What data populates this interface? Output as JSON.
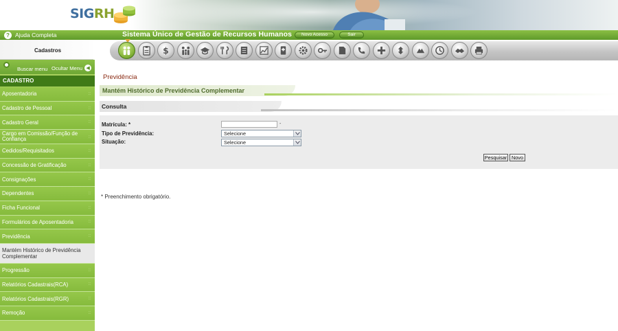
{
  "header": {
    "logo": {
      "part1": "SIG",
      "part2": "RH"
    },
    "help_link": "Ajuda Completa",
    "system_title": "Sistema Único de Gestão de Recursos Humanos",
    "novo_acesso": "Novo Acesso",
    "sair": "Sair"
  },
  "section_tab": "Cadastros",
  "module_icons": [
    "people-icon",
    "clipboard-icon",
    "dollar-icon",
    "family-icon",
    "graduation-cap-icon",
    "tools-icon",
    "document-icon",
    "chart-icon",
    "doctor-icon",
    "gear-icon",
    "key-icon",
    "page-icon",
    "phone-icon",
    "plus-icon",
    "transfer-icon",
    "hands-icon",
    "clock-icon",
    "handshake-icon",
    "printer-icon"
  ],
  "sidebar": {
    "buscar_menu": "Buscar menu",
    "ocultar_menu": "Ocultar Menu",
    "header": "CADASTRO",
    "items": [
      "Aposentadoria",
      "Cadastro de Pessoal",
      "Cadastro Geral",
      "Cargo em Comissão/Função de Confiança",
      "Cedidos/Requisitados",
      "Concessão de Gratificação",
      "Consignações",
      "Dependentes",
      "Ficha Funcional",
      "Formulários de Aposentadoria",
      "Previdência",
      "Mantém Histórico de Previdência Complementar",
      "Progressão",
      "Relatórios Cadastrais(RCA)",
      "Relatórios Cadastrais(RGR)",
      "Remoção"
    ]
  },
  "content": {
    "page_title": "Previdência",
    "subtitle": "Mantém Histórico de Previdência Complementar",
    "consulta": "Consulta",
    "form": {
      "matricula_label": "Matrícula: *",
      "matricula_value": "",
      "tipo_label": "Tipo de Previdência:",
      "tipo_value": "Selecione",
      "situacao_label": "Situação:",
      "situacao_value": "Selecione"
    },
    "btn_pesquisar": "Pesquisar",
    "btn_novo": "Novo",
    "required_note": "* Preenchimento obrigatório."
  }
}
